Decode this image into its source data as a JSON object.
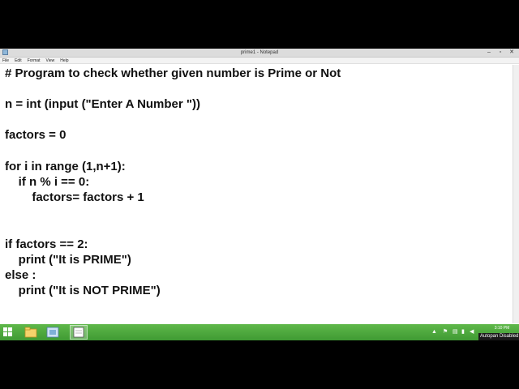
{
  "window": {
    "title": "prime1 - Notepad",
    "controls": {
      "minimize": "–",
      "maximize": "▫",
      "close": "✕"
    }
  },
  "menu": [
    "File",
    "Edit",
    "Format",
    "View",
    "Help"
  ],
  "code_lines": [
    "# Program to check whether given number is Prime or Not",
    "n = int (input (\"Enter A Number \"))",
    "factors = 0",
    "for i in range (1,n+1):",
    "    if n % i == 0:",
    "        factors= factors + 1",
    "if factors == 2:",
    "    print (\"It is PRIME\")",
    "else :",
    "    print (\"It is NOT PRIME\")"
  ],
  "taskbar": {
    "apps": [
      "start-icon",
      "file-explorer-icon",
      "python-idle-icon",
      "notepad-icon"
    ],
    "clock": "3:10 PM",
    "notification": "Autopan Disabled"
  },
  "colors": {
    "taskbar": "#4aa83c",
    "titlebar": "#dcdcdc",
    "text": "#111111"
  }
}
